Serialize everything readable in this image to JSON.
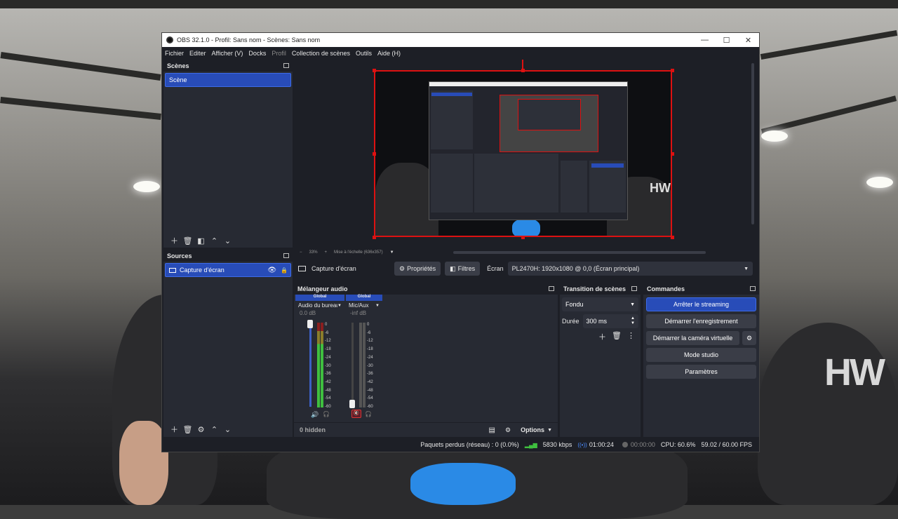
{
  "window": {
    "title": "OBS 32.1.0 - Profil: Sans nom - Scènes: Sans nom",
    "controls": {
      "minimize": "—",
      "maximize": "☐",
      "close": "✕"
    }
  },
  "menu": [
    "Fichier",
    "Editer",
    "Afficher (V)",
    "Docks",
    "Profil",
    "Collection de scènes",
    "Outils",
    "Aide (H)"
  ],
  "scenes": {
    "title": "Scènes",
    "items": [
      "Scène"
    ]
  },
  "sources": {
    "title": "Sources",
    "items": [
      "Capture d'écran"
    ]
  },
  "preview": {
    "zoom": "33%",
    "scale_mode": "Mise à l'échelle (636x357)"
  },
  "context_bar": {
    "source_name": "Capture d'écran",
    "properties": "Propriétés",
    "filters": "Filtres",
    "screen_label": "Écran",
    "screen_value": "PL2470H: 1920x1080 @ 0,0 (Écran principal)"
  },
  "audio_mixer": {
    "title": "Mélangeur audio",
    "channels": [
      {
        "badge": "Global",
        "name": "Audio du bureau",
        "level": "0.0 dB",
        "muted": false
      },
      {
        "badge": "Global",
        "name": "Mic/Aux",
        "level": "-inf dB",
        "muted": true
      }
    ],
    "scale": [
      "0",
      "-6",
      "-12",
      "-18",
      "-24",
      "-30",
      "-36",
      "-42",
      "-48",
      "-54",
      "-60"
    ],
    "hidden": "0 hidden",
    "options": "Options"
  },
  "transitions": {
    "title": "Transition de scènes",
    "transition": "Fondu",
    "duration_label": "Durée",
    "duration_value": "300 ms"
  },
  "controls": {
    "title": "Commandes",
    "stop_streaming": "Arrêter le streaming",
    "start_recording": "Démarrer l'enregistrement",
    "start_virtual_cam": "Démarrer la caméra virtuelle",
    "studio_mode": "Mode studio",
    "settings": "Paramètres"
  },
  "status": {
    "dropped_frames": "Paquets perdus (réseau) : 0 (0.0%)",
    "bitrate": "5830 kbps",
    "stream_time": "01:00:24",
    "rec_time": "00:00:00",
    "cpu": "CPU: 60.6%",
    "fps": "59.02 / 60.00 FPS"
  },
  "colors": {
    "accent": "#284cb8",
    "live_red": "#d11111",
    "meter_green": "#3fbf3f"
  }
}
